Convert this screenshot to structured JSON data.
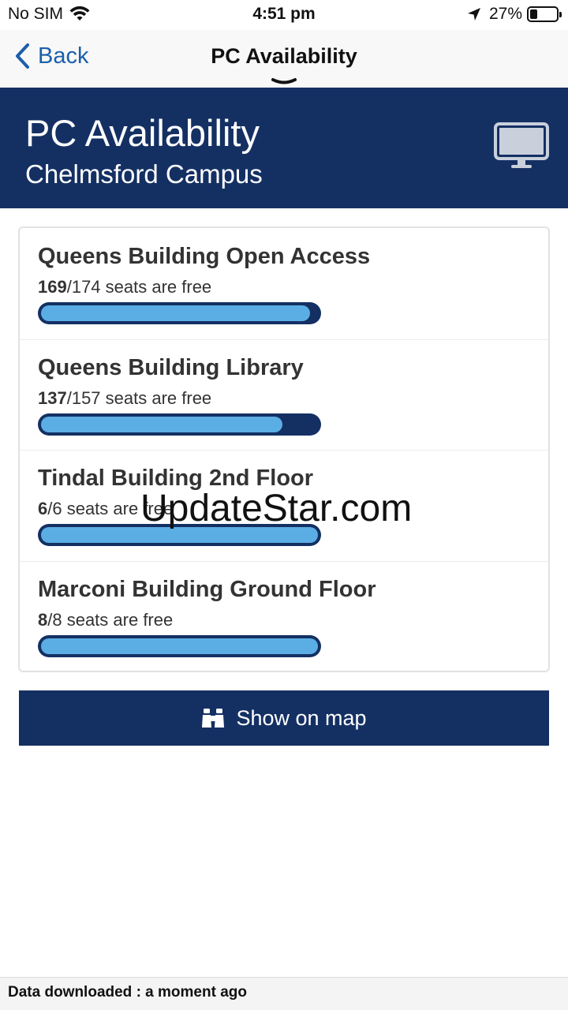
{
  "status_bar": {
    "carrier": "No SIM",
    "time": "4:51 pm",
    "battery_percent": "27%",
    "battery_level": 0.27,
    "icons": [
      "wifi-icon",
      "location-arrow-icon",
      "battery-icon"
    ]
  },
  "nav": {
    "back_label": "Back",
    "title": "PC Availability"
  },
  "banner": {
    "title": "PC Availability",
    "subtitle": "Chelmsford Campus",
    "icon": "desktop-computer-icon"
  },
  "locations": [
    {
      "name": "Queens Building Open Access",
      "free": "169",
      "total": "/174 seats are free",
      "fraction": 0.971
    },
    {
      "name": "Queens Building Library",
      "free": "137",
      "total": "/157 seats are free",
      "fraction": 0.873
    },
    {
      "name": "Tindal Building 2nd Floor",
      "free": "6",
      "total": "/6 seats are free",
      "fraction": 1.0
    },
    {
      "name": "Marconi Building Ground Floor",
      "free": "8",
      "total": "/8 seats are free",
      "fraction": 1.0
    }
  ],
  "map_button": {
    "label": "Show on map",
    "icon": "binoculars-icon"
  },
  "watermark": "UpdateStar.com",
  "footer": {
    "text": "Data downloaded : a moment ago"
  },
  "colors": {
    "brand_navy": "#143063",
    "bar_fill": "#5baee3",
    "link_blue": "#1b5faa"
  }
}
